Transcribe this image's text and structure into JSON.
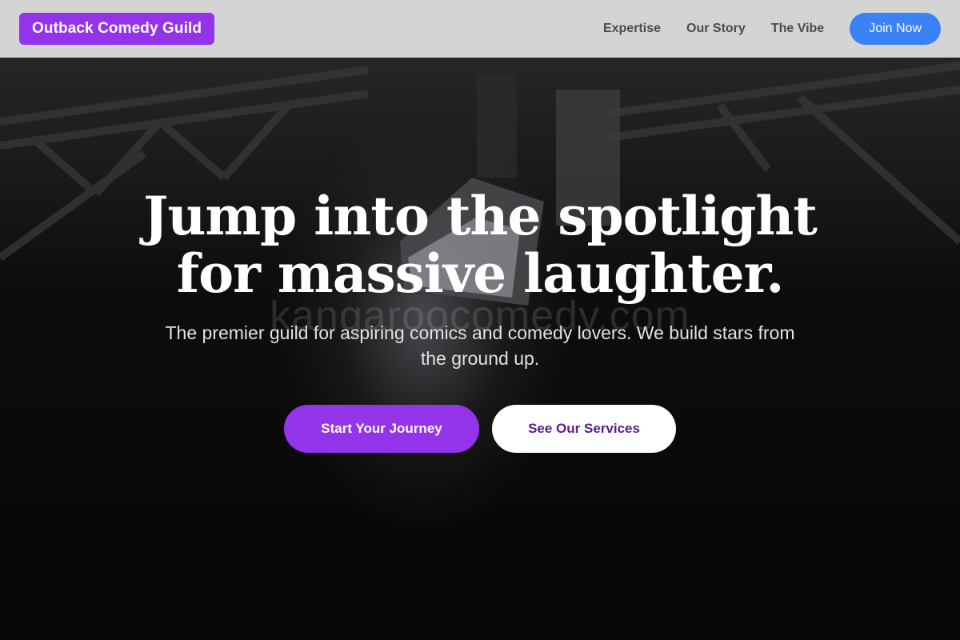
{
  "nav": {
    "logo": "Outback Comedy Guild",
    "links": [
      "Expertise",
      "Our Story",
      "The Vibe"
    ],
    "cta": "Join Now"
  },
  "hero": {
    "headline_line1": "Jump into the spotlight",
    "headline_line2": "for massive laughter.",
    "subtitle": "The premier guild for aspiring comics and comedy lovers. We build stars from the ground up.",
    "watermark": "kangaroocomedy.com",
    "primary_cta": "Start Your Journey",
    "secondary_cta": "See Our Services"
  },
  "colors": {
    "brand_purple": "#9333ea",
    "join_blue": "#3b82f6",
    "nav_bg": "#d4d4d4",
    "secondary_text": "#5b1b8c"
  }
}
